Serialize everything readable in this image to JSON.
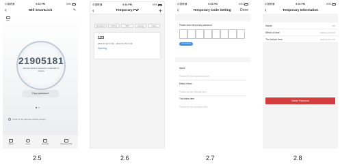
{
  "status_bar": {
    "s1": {
      "carrier": "中国联通",
      "time": "9:33 PM",
      "right": "94%"
    },
    "s2": {
      "carrier": "中国联通",
      "time": "9:34 PM",
      "right": "93%"
    },
    "s3": {
      "carrier": "中国联通",
      "time": "9:33 PM",
      "right": "94%"
    },
    "s4": {
      "carrier": "中国联通",
      "time": "9:34 PM",
      "right": "93%"
    }
  },
  "screen1": {
    "title": "Wifi SmartLock",
    "wifi_label": "WiFi",
    "code": "21905181",
    "code_desc": "Remote dynamic password, invalid after 5 minutes",
    "copy_label": "Copy password",
    "log_text": "11-24 17:22, Remote Unlock via App",
    "tabs": [
      "Album",
      "Users",
      "Records",
      "Temporary PW"
    ]
  },
  "screen2": {
    "title": "Temporary PW",
    "add_icon": "+",
    "filters": [
      "Not Started",
      "Syncing",
      "Valid",
      "Deleting",
      "Invalid"
    ],
    "card": {
      "name": "123",
      "time_range": "2020-11-24 17:33 ~ 2020-11-25 17:33",
      "status": "Syncing"
    }
  },
  "screen3": {
    "title": "Temporary Code Setting",
    "done_label": "Done",
    "enter_label": "Please enter temporary password",
    "generate_label": "Get randomly",
    "name_label": "Name",
    "name_placeholder": "Please set the password name",
    "effect_label": "Effect of time",
    "effect_placeholder": "Please set the effective time",
    "failure_label": "The failure time",
    "failure_placeholder": "Please set the expiration time"
  },
  "screen4": {
    "title": "Temporary Information",
    "rows": [
      {
        "key": "Name",
        "value": "123"
      },
      {
        "key": "Effect of time",
        "value": "2020-11-24 17:33"
      },
      {
        "key": "The failure time",
        "value": "2020-11-25 17:33"
      }
    ],
    "delete_label": "Delete Password"
  },
  "captions": [
    "2.5",
    "2.6",
    "2.7",
    "2.8"
  ],
  "colors": {
    "accent_blue": "#2f6fb7",
    "delete_red": "#d43d3d"
  }
}
